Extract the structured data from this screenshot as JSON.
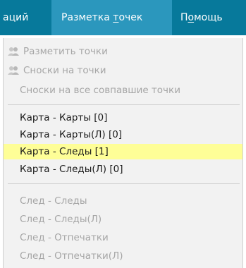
{
  "menubar": {
    "items": [
      {
        "label": "аций",
        "state": "normal"
      },
      {
        "label_pre": "Разметка ",
        "label_ul": "т",
        "label_post": "очек",
        "state": "active"
      },
      {
        "label_pre": "П",
        "label_ul": "о",
        "label_post": "мощь",
        "state": "normal"
      }
    ]
  },
  "colors": {
    "menubar_bg": "#07799b",
    "menubar_active_bg": "#2b97bd",
    "dropdown_bg": "#f2f2f2",
    "highlight_bg": "#fefe97",
    "disabled_text": "#a6a6a6"
  },
  "dropdown": {
    "group1": [
      {
        "label": "Разметить точки",
        "icon": "users-icon",
        "enabled": false
      },
      {
        "label": "Сноски на точки",
        "icon": "users-icon",
        "enabled": false
      },
      {
        "label": "Сноски на все совпавшие точки",
        "icon": null,
        "enabled": false
      }
    ],
    "group2": [
      {
        "label": "Карта - Карты  [0]",
        "enabled": true,
        "highlighted": false
      },
      {
        "label": "Карта - Карты(Л)  [0]",
        "enabled": true,
        "highlighted": false
      },
      {
        "label": "Карта - Следы  [1]",
        "enabled": true,
        "highlighted": true
      },
      {
        "label": "Карта - Следы(Л)  [0]",
        "enabled": true,
        "highlighted": false
      }
    ],
    "group3": [
      {
        "label": "След - Следы",
        "enabled": false
      },
      {
        "label": "След - Следы(Л)",
        "enabled": false
      },
      {
        "label": "След - Отпечатки",
        "enabled": false
      },
      {
        "label": "След - Отпечатки(Л)",
        "enabled": false
      }
    ]
  }
}
